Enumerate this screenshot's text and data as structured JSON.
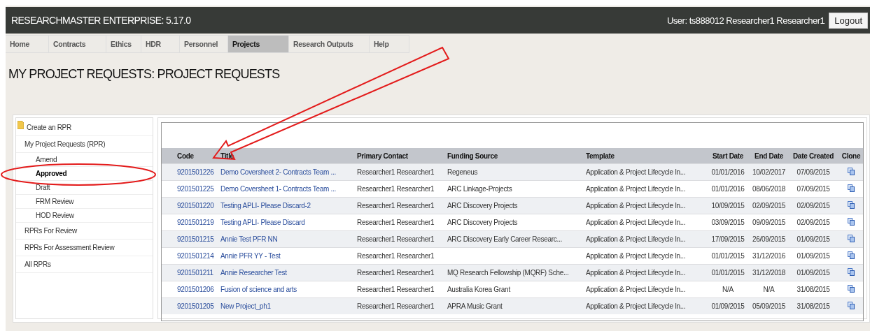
{
  "header": {
    "app_title": "RESEARCHMASTER ENTERPRISE: 5.17.0",
    "user": "User: ts888012 Researcher1 Researcher1",
    "logout": "Logout"
  },
  "nav": [
    {
      "label": "Home",
      "selected": false
    },
    {
      "label": "Contracts",
      "selected": false
    },
    {
      "label": "Ethics",
      "selected": false
    },
    {
      "label": "HDR",
      "selected": false
    },
    {
      "label": "Personnel",
      "selected": false
    },
    {
      "label": "Projects",
      "selected": true
    },
    {
      "label": "Research Outputs",
      "selected": false
    },
    {
      "label": "Help",
      "selected": false
    }
  ],
  "page_title": "MY PROJECT REQUESTS: PROJECT REQUESTS",
  "sidebar": {
    "items": [
      {
        "label": "Create an RPR",
        "kind": "action",
        "selected": false
      },
      {
        "label": "My Project Requests (RPR)",
        "kind": "link",
        "selected": false,
        "children": [
          {
            "label": "Amend",
            "kind": "link",
            "selected": false
          },
          {
            "label": "Approved",
            "kind": "link",
            "selected": true
          },
          {
            "label": "Draft",
            "kind": "link",
            "selected": false
          },
          {
            "label": "FRM Review",
            "kind": "link",
            "selected": false
          },
          {
            "label": "HOD Review",
            "kind": "link",
            "selected": false
          }
        ]
      },
      {
        "label": "RPRs For Review",
        "kind": "link",
        "selected": false
      },
      {
        "label": "RPRs For Assessment Review",
        "kind": "link",
        "selected": false
      },
      {
        "label": "All RPRs",
        "kind": "link",
        "selected": false
      }
    ]
  },
  "table": {
    "columns": [
      "Code",
      "Title",
      "Primary Contact",
      "Funding Source",
      "Template",
      "Start Date",
      "End Date",
      "Date Created",
      "Clone"
    ],
    "rows": [
      {
        "code": "9201501226",
        "title": "Demo Coversheet 2- Contracts Team ...",
        "contact": "Researcher1 Researcher1",
        "funding": "Regeneus",
        "template": "Application & Project Lifecycle In...",
        "start": "01/01/2016",
        "end": "10/02/2017",
        "created": "07/09/2015"
      },
      {
        "code": "9201501225",
        "title": "Demo Coversheet 1- Contracts Team ...",
        "contact": "Researcher1 Researcher1",
        "funding": "ARC Linkage-Projects",
        "template": "Application & Project Lifecycle In...",
        "start": "01/01/2016",
        "end": "08/06/2018",
        "created": "07/09/2015"
      },
      {
        "code": "9201501220",
        "title": "Testing APLI- Please Discard-2",
        "contact": "Researcher1 Researcher1",
        "funding": "ARC Discovery Projects",
        "template": "Application & Project Lifecycle In...",
        "start": "10/09/2015",
        "end": "02/09/2015",
        "created": "02/09/2015"
      },
      {
        "code": "9201501219",
        "title": "Testing APLI- Please Discard",
        "contact": "Researcher1 Researcher1",
        "funding": "ARC Discovery Projects",
        "template": "Application & Project Lifecycle In...",
        "start": "03/09/2015",
        "end": "09/09/2015",
        "created": "02/09/2015"
      },
      {
        "code": "9201501215",
        "title": "Annie Test PFR NN",
        "contact": "Researcher1 Researcher1",
        "funding": "ARC Discovery Early Career Researc...",
        "template": "Application & Project Lifecycle In...",
        "start": "17/09/2015",
        "end": "26/09/2015",
        "created": "01/09/2015"
      },
      {
        "code": "9201501214",
        "title": "Annie PFR YY - Test",
        "contact": "Researcher1 Researcher1",
        "template": "Application & Project Lifecycle In...",
        "start": "01/01/2015",
        "end": "31/12/2016",
        "created": "01/09/2015"
      },
      {
        "code": "9201501211",
        "title": "Annie Researcher Test",
        "contact": "Researcher1 Researcher1",
        "funding": "MQ Research Fellowship (MQRF) Sche...",
        "template": "Application & Project Lifecycle In...",
        "start": "01/01/2015",
        "end": "31/12/2018",
        "created": "01/09/2015"
      },
      {
        "code": "9201501206",
        "title": "Fusion of science and arts",
        "contact": "Researcher1 Researcher1",
        "funding": "Australia Korea Grant",
        "template": "Application & Project Lifecycle In...",
        "start": "N/A",
        "end": "N/A",
        "created": "31/08/2015"
      },
      {
        "code": "9201501205",
        "title": "New Project_ph1",
        "contact": "Researcher1 Researcher1",
        "funding": "APRA Music Grant",
        "template": "Application & Project Lifecycle In...",
        "start": "01/09/2015",
        "end": "05/09/2015",
        "created": "31/08/2015"
      }
    ]
  }
}
